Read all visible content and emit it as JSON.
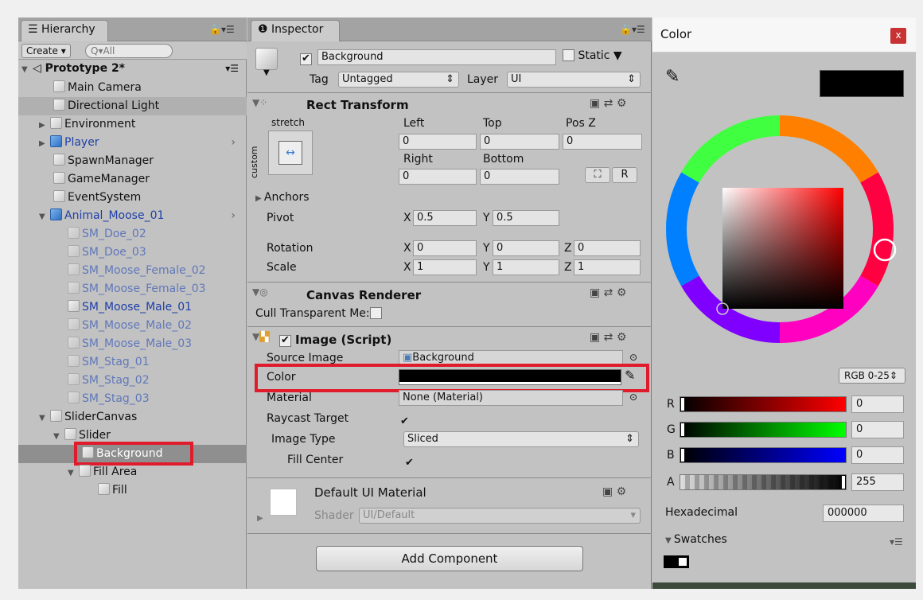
{
  "hierarchy": {
    "tab": "Hierarchy",
    "create": "Create",
    "search_placeholder": "Q▾All",
    "scene": "Prototype 2*",
    "items": [
      {
        "label": "Main Camera"
      },
      {
        "label": "Directional Light"
      },
      {
        "label": "Environment"
      },
      {
        "label": "Player"
      },
      {
        "label": "SpawnManager"
      },
      {
        "label": "GameManager"
      },
      {
        "label": "EventSystem"
      },
      {
        "label": "Animal_Moose_01"
      },
      {
        "label": "SM_Doe_02"
      },
      {
        "label": "SM_Doe_03"
      },
      {
        "label": "SM_Moose_Female_02"
      },
      {
        "label": "SM_Moose_Female_03"
      },
      {
        "label": "SM_Moose_Male_01"
      },
      {
        "label": "SM_Moose_Male_02"
      },
      {
        "label": "SM_Moose_Male_03"
      },
      {
        "label": "SM_Stag_01"
      },
      {
        "label": "SM_Stag_02"
      },
      {
        "label": "SM_Stag_03"
      },
      {
        "label": "SliderCanvas"
      },
      {
        "label": "Slider"
      },
      {
        "label": "Background"
      },
      {
        "label": "Fill Area"
      },
      {
        "label": "Fill"
      }
    ]
  },
  "inspector": {
    "tab": "Inspector",
    "object_name": "Background",
    "static_label": "Static",
    "tag_label": "Tag",
    "tag_value": "Untagged",
    "layer_label": "Layer",
    "layer_value": "UI",
    "rect": {
      "title": "Rect Transform",
      "stretch": "stretch",
      "custom": "custom",
      "left_label": "Left",
      "left": "0",
      "top_label": "Top",
      "top": "0",
      "posz_label": "Pos Z",
      "posz": "0",
      "right_label": "Right",
      "right": "0",
      "bottom_label": "Bottom",
      "bottom": "0",
      "r_button": "R",
      "anchors": "Anchors",
      "pivot_label": "Pivot",
      "pivot_x": "0.5",
      "pivot_y": "0.5",
      "rotation_label": "Rotation",
      "rot_x": "0",
      "rot_y": "0",
      "rot_z": "0",
      "scale_label": "Scale",
      "scale_x": "1",
      "scale_y": "1",
      "scale_z": "1",
      "x": "X",
      "y": "Y",
      "z": "Z"
    },
    "canvas_renderer": {
      "title": "Canvas Renderer",
      "cull_label": "Cull Transparent Me:"
    },
    "image": {
      "title": "Image (Script)",
      "source_label": "Source Image",
      "source_value": "Background",
      "color_label": "Color",
      "color_value": "#000000",
      "material_label": "Material",
      "material_value": "None (Material)",
      "raycast_label": "Raycast Target",
      "type_label": "Image Type",
      "type_value": "Sliced",
      "fill_label": "Fill Center"
    },
    "material": {
      "name": "Default UI Material",
      "shader_label": "Shader",
      "shader_value": "UI/Default"
    },
    "add_component": "Add Component"
  },
  "color_picker": {
    "title": "Color",
    "close": "x",
    "preview": "#000000",
    "mode": "RGB 0-25",
    "r_label": "R",
    "r": "0",
    "g_label": "G",
    "g": "0",
    "b_label": "B",
    "b": "0",
    "a_label": "A",
    "a": "255",
    "hex_label": "Hexadecimal",
    "hex": "000000",
    "swatches_label": "Swatches"
  }
}
